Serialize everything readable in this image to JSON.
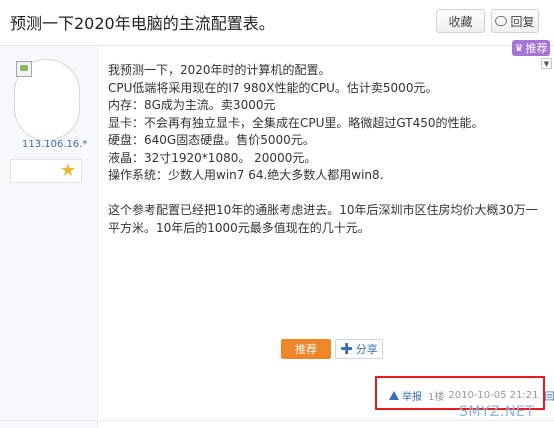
{
  "header": {
    "title": "预测一下2020年电脑的主流配置表。",
    "collect_label": "收藏",
    "reply_label": "回复"
  },
  "user": {
    "ip": "113.106.16.*",
    "badge_icon": "star-icon"
  },
  "recommend_badge": {
    "label": "推荐",
    "icon": "trophy-icon",
    "color": "#a574d6"
  },
  "post": {
    "lines": [
      "我预测一下，2020年时的计算机的配置。",
      "CPU低端将采用现在的I7 980X性能的CPU。估计卖5000元。",
      "内存：8G成为主流。卖3000元",
      "显卡：不会再有独立显卡，全集成在CPU里。略微超过GT450的性能。",
      "硬盘：640G固态硬盘。售价5000元。",
      "液晶：32寸1920*1080。 20000元。",
      "操作系统：少数人用win7 64.绝大多数人都用win8."
    ],
    "closing": "这个参考配置已经把10年的通胀考虑进去。10年后深圳市区住房均价大概30万一平方米。10年后的1000元最多值现在的几十元。"
  },
  "actions": {
    "recommend_label": "推荐",
    "recommend_color": "#f0862a",
    "share_label": "分享"
  },
  "meta": {
    "report_label": "举报",
    "floor": "1楼",
    "time": "2010-10-05 21:21",
    "reply_label": "回复"
  },
  "watermark": "SMYZ.NET"
}
